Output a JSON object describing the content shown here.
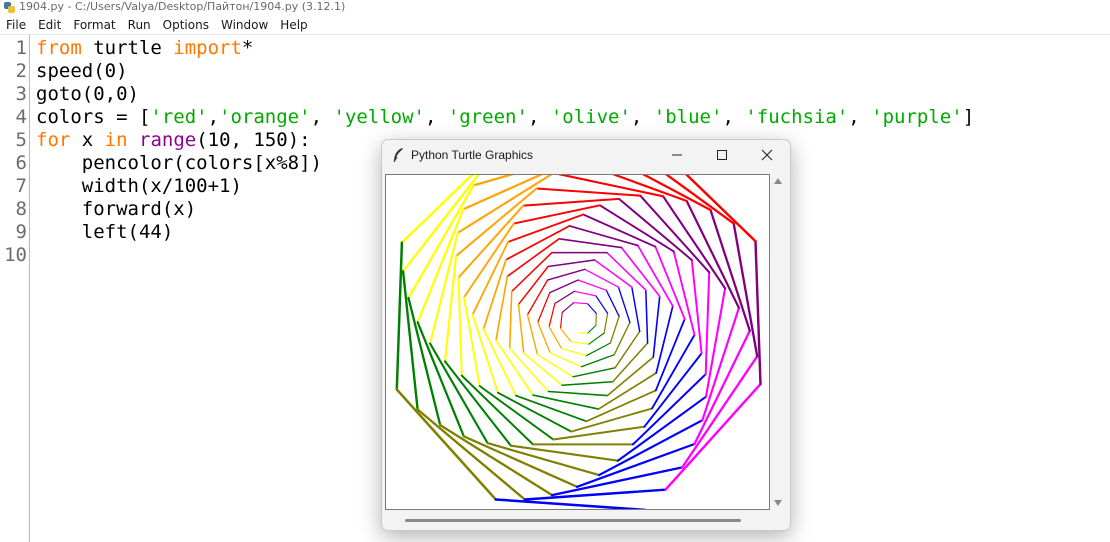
{
  "window": {
    "title": "1904.py - C:/Users/Valya/Desktop/Пайтон/1904.py (3.12.1)"
  },
  "menu": [
    "File",
    "Edit",
    "Format",
    "Run",
    "Options",
    "Window",
    "Help"
  ],
  "editor": {
    "line_numbers": [
      "1",
      "2",
      "3",
      "4",
      "5",
      "6",
      "7",
      "8",
      "9",
      "10"
    ],
    "code_lines": [
      [
        {
          "t": "from",
          "c": "kw"
        },
        {
          "t": " turtle "
        },
        {
          "t": "import",
          "c": "kw"
        },
        {
          "t": "*"
        }
      ],
      [
        {
          "t": "speed(0)"
        }
      ],
      [
        {
          "t": "goto(0,0)"
        }
      ],
      [
        {
          "t": "colors = ["
        },
        {
          "t": "'red'",
          "c": "str"
        },
        {
          "t": ","
        },
        {
          "t": "'orange'",
          "c": "str"
        },
        {
          "t": ", "
        },
        {
          "t": "'yellow'",
          "c": "str"
        },
        {
          "t": ", "
        },
        {
          "t": "'green'",
          "c": "str"
        },
        {
          "t": ", "
        },
        {
          "t": "'olive'",
          "c": "str"
        },
        {
          "t": ", "
        },
        {
          "t": "'blue'",
          "c": "str"
        },
        {
          "t": ", "
        },
        {
          "t": "'fuchsia'",
          "c": "str"
        },
        {
          "t": ", "
        },
        {
          "t": "'purple'",
          "c": "str"
        },
        {
          "t": "]"
        }
      ],
      [
        {
          "t": "for",
          "c": "kw"
        },
        {
          "t": " x "
        },
        {
          "t": "in",
          "c": "kw"
        },
        {
          "t": " "
        },
        {
          "t": "range",
          "c": "bi"
        },
        {
          "t": "(10, 150):"
        }
      ],
      [
        {
          "t": "    pencolor(colors[x%8])"
        }
      ],
      [
        {
          "t": "    width(x/100+1)"
        }
      ],
      [
        {
          "t": "    forward(x)"
        }
      ],
      [
        {
          "t": "    left(44)"
        }
      ],
      [
        {
          "t": ""
        }
      ]
    ]
  },
  "turtle_window": {
    "title": "Python Turtle Graphics",
    "drawing": {
      "start": 10,
      "end": 150,
      "turn_degrees": 44,
      "colors": [
        "#ff0000",
        "#ffa500",
        "#ffff00",
        "#008000",
        "#808000",
        "#0000ff",
        "#ff00ff",
        "#800080"
      ]
    }
  },
  "colors": {
    "keyword": "#ff7700",
    "builtin": "#900090",
    "string": "#00aa00"
  }
}
